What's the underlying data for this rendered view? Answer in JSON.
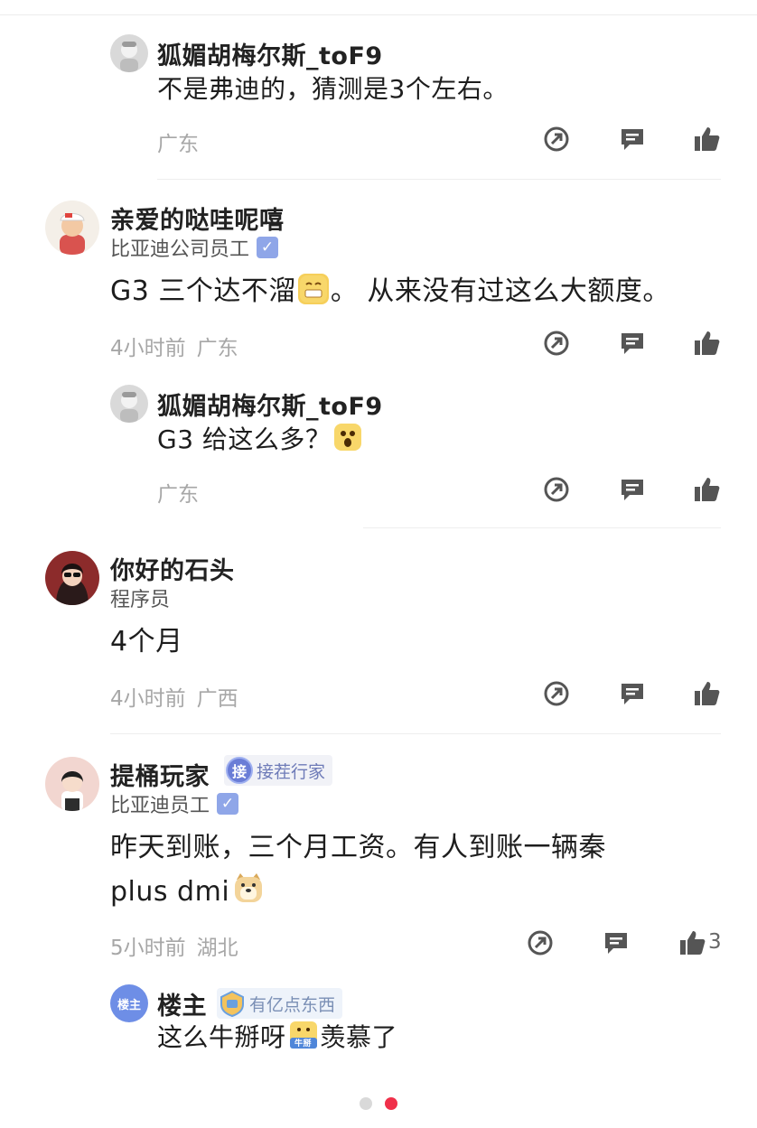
{
  "comments": [
    {
      "name": "狐媚胡梅尔斯_toF9",
      "text": "不是弗迪的，猜测是3个左右。",
      "time": "",
      "location": "广东"
    },
    {
      "name": "亲爱的哒哇呢嘻",
      "title": "比亚迪公司员工",
      "text": "G3 三个达不溜",
      "text_after_emoji": "。 从来没有过这么大额度。",
      "time": "4小时前",
      "location": "广东"
    },
    {
      "name": "狐媚胡梅尔斯_toF9",
      "text": "G3 给这么多？",
      "time": "",
      "location": "广东"
    },
    {
      "name": "你好的石头",
      "title": "程序员",
      "text": "4个月",
      "time": "4小时前",
      "location": "广西"
    },
    {
      "name": "提桶玩家",
      "badge_icon": "接",
      "badge_label": "接茬行家",
      "title": "比亚迪员工",
      "text_line1": "昨天到账，三个月工资。有人到账一辆秦",
      "text_line2": "plus dmi",
      "time": "5小时前",
      "location": "湖北",
      "likes": "3"
    },
    {
      "name": "楼主",
      "avatar_label": "楼主",
      "badge_label": "有亿点东西",
      "text": "这么牛掰呀",
      "emoji_label": "牛掰",
      "text_after_emoji": "羡慕了"
    }
  ],
  "icons": {
    "share": "share-icon",
    "reply": "comment-icon",
    "like": "thumbs-up-icon"
  },
  "colors": {
    "verified": "#8fa6e8",
    "accent_red": "#f0304a",
    "meta_gray": "#a7a7a7"
  },
  "pagination": {
    "total": 2,
    "active": 2
  }
}
